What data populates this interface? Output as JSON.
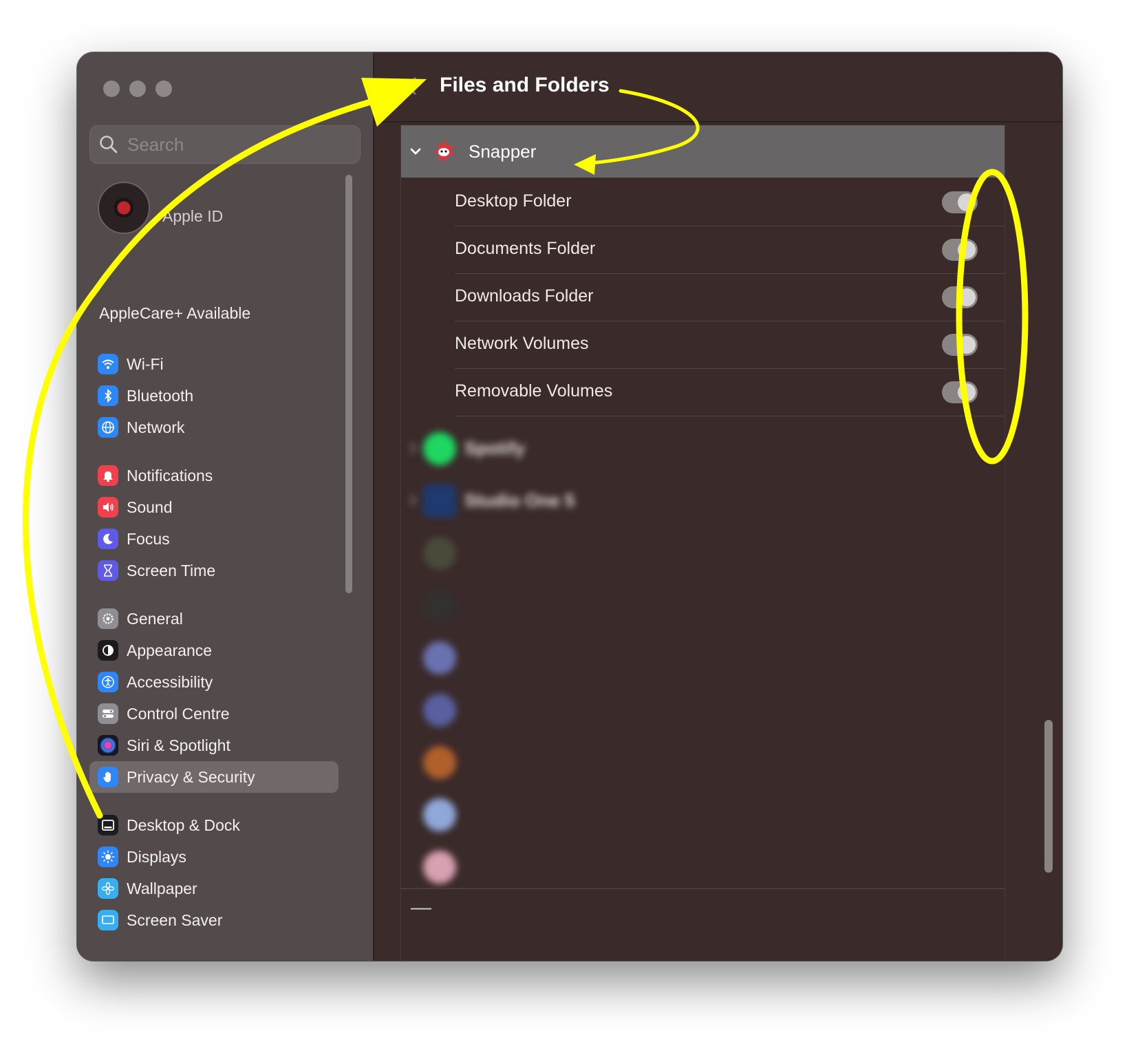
{
  "window": {
    "title": "Files and Folders"
  },
  "sidebar": {
    "search_placeholder": "Search",
    "apple_id_label": "Apple ID",
    "applecare_label": "AppleCare+ Available",
    "items": [
      {
        "label": "Wi-Fi",
        "icon": "wifi-icon",
        "color": "#2f86f6"
      },
      {
        "label": "Bluetooth",
        "icon": "bluetooth-icon",
        "color": "#2f86f6"
      },
      {
        "label": "Network",
        "icon": "globe-icon",
        "color": "#2f86f6"
      },
      {
        "label": "Notifications",
        "icon": "bell-icon",
        "color": "#f0424e"
      },
      {
        "label": "Sound",
        "icon": "speaker-icon",
        "color": "#f0424e"
      },
      {
        "label": "Focus",
        "icon": "moon-icon",
        "color": "#5e5ce6"
      },
      {
        "label": "Screen Time",
        "icon": "hourglass-icon",
        "color": "#5e5ce6"
      },
      {
        "label": "General",
        "icon": "gear-icon",
        "color": "#8e8e93"
      },
      {
        "label": "Appearance",
        "icon": "appearance-icon",
        "color": "#1c1c1e"
      },
      {
        "label": "Accessibility",
        "icon": "accessibility-icon",
        "color": "#2f86f6"
      },
      {
        "label": "Control Centre",
        "icon": "control-centre-icon",
        "color": "#8e8e93"
      },
      {
        "label": "Siri & Spotlight",
        "icon": "siri-icon",
        "color": "#3a2a5a"
      },
      {
        "label": "Privacy & Security",
        "icon": "hand-icon",
        "color": "#2f86f6",
        "selected": true
      },
      {
        "label": "Desktop & Dock",
        "icon": "dock-icon",
        "color": "#1c1c1e"
      },
      {
        "label": "Displays",
        "icon": "sun-icon",
        "color": "#2f86f6"
      },
      {
        "label": "Wallpaper",
        "icon": "flower-icon",
        "color": "#37aef0"
      },
      {
        "label": "Screen Saver",
        "icon": "screensaver-icon",
        "color": "#37aef0"
      }
    ]
  },
  "main": {
    "selected_app": {
      "name": "Snapper",
      "icon": "snapper-app-icon",
      "permissions": [
        {
          "label": "Desktop Folder",
          "enabled": true
        },
        {
          "label": "Documents Folder",
          "enabled": true
        },
        {
          "label": "Downloads Folder",
          "enabled": true
        },
        {
          "label": "Network Volumes",
          "enabled": true
        },
        {
          "label": "Removable Volumes",
          "enabled": true
        }
      ]
    },
    "other_apps": [
      {
        "name": "Spotify",
        "icon": "spotify-icon",
        "color": "#1ed760"
      },
      {
        "name": "Studio One 5",
        "icon": "studio-one-icon",
        "color": "#1e3a6e"
      }
    ],
    "blurred_rows": [
      {
        "color": "#4a4a3a"
      },
      {
        "color": "#333030"
      },
      {
        "color": "#6a72b0"
      },
      {
        "color": "#5860a0"
      },
      {
        "color": "#b0602a"
      },
      {
        "color": "#8fa8d8"
      },
      {
        "color": "#d8a0b0"
      }
    ],
    "remove_button_label": "—"
  },
  "annotations": {
    "highlight_color": "#ffff00"
  }
}
